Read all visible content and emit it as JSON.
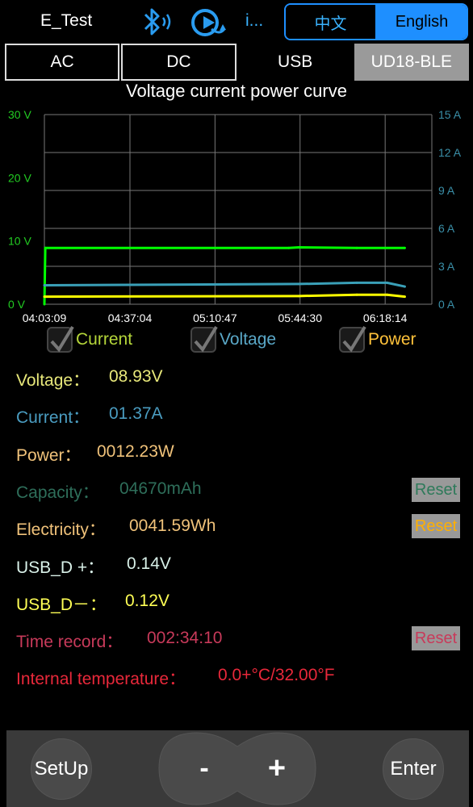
{
  "header": {
    "app_title": "E_Test",
    "info_label": "i...",
    "icons": {
      "bluetooth": "bluetooth-icon",
      "refresh": "refresh-icon"
    },
    "languages": {
      "chinese": "中文",
      "english": "English",
      "active": "English"
    }
  },
  "tabs": [
    {
      "label": "AC"
    },
    {
      "label": "DC"
    },
    {
      "label": "USB"
    },
    {
      "label": "UD18-BLE",
      "active": true
    }
  ],
  "chart_data": {
    "type": "line",
    "title": "Voltage current power curve",
    "x_ticks": [
      "04:03:09",
      "04:37:04",
      "05:10:47",
      "05:44:30",
      "06:18:14"
    ],
    "y_left": {
      "ticks": [
        "0 V",
        "10 V",
        "20 V",
        "30 V"
      ],
      "range": [
        0,
        30
      ],
      "unit": "V",
      "color": "#22cc22"
    },
    "y_right": {
      "ticks": [
        "0 A",
        "3 A",
        "6 A",
        "9 A",
        "12 A",
        "15 A"
      ],
      "range": [
        0,
        15
      ],
      "unit": "A",
      "color": "#3a8fa8"
    },
    "grid": true,
    "series": [
      {
        "name": "Voltage",
        "color": "#00ff00",
        "axis": "left",
        "x": [
          "04:03:09",
          "04:03:30",
          "05:40:00",
          "05:44:00",
          "06:07:00",
          "06:26:00"
        ],
        "values": [
          0,
          8.9,
          8.9,
          9.0,
          8.9,
          8.9
        ]
      },
      {
        "name": "Current",
        "color": "#3aa0b8",
        "axis": "right",
        "x": [
          "04:03:09",
          "05:44:00",
          "06:07:00",
          "06:19:00",
          "06:26:00"
        ],
        "values": [
          1.5,
          1.6,
          1.7,
          1.7,
          1.4
        ]
      },
      {
        "name": "Power",
        "color": "#ffff00",
        "axis": "left",
        "x": [
          "04:03:09",
          "05:44:00",
          "06:07:00",
          "06:19:00",
          "06:26:00"
        ],
        "values": [
          1.2,
          1.3,
          1.5,
          1.5,
          1.2
        ]
      }
    ]
  },
  "legend": [
    {
      "label": "Current",
      "color": "#b5d63a",
      "checked": true
    },
    {
      "label": "Voltage",
      "color": "#5aa8c8",
      "checked": true
    },
    {
      "label": "Power",
      "color": "#ffc23a",
      "checked": true
    }
  ],
  "readings": {
    "voltage": {
      "label": "Voltage：",
      "value": "08.93V",
      "color": "#e8e87a"
    },
    "current": {
      "label": "Current：",
      "value": "01.37A",
      "color": "#4a9cc0"
    },
    "power": {
      "label": "Power：",
      "value": "0012.23W",
      "color": "#f0c27a"
    },
    "capacity": {
      "label": "Capacity：",
      "value": "04670mAh",
      "color": "#2e6e5a",
      "reset": "Reset",
      "reset_color": "#2e7a5a"
    },
    "electricity": {
      "label": "Electricity：",
      "value": "0041.59Wh",
      "color": "#f0c27a",
      "reset": "Reset",
      "reset_color": "#ffb000"
    },
    "usb_dp": {
      "label": "USB_D +：",
      "value": "0.14V",
      "color": "#d8f0e8"
    },
    "usb_dm": {
      "label": "USB_D－：",
      "value": "0.12V",
      "color": "#ffff55"
    },
    "time_record": {
      "label": "Time record：",
      "value": "002:34:10",
      "color": "#c83a5a",
      "reset": "Reset",
      "reset_color": "#c83a5a"
    },
    "temperature": {
      "label": "Internal temperature：",
      "value": "0.0+°C/32.00°F",
      "color": "#e8283a"
    }
  },
  "controls": {
    "setup": "SetUp",
    "minus": "-",
    "plus": "+",
    "enter": "Enter"
  }
}
